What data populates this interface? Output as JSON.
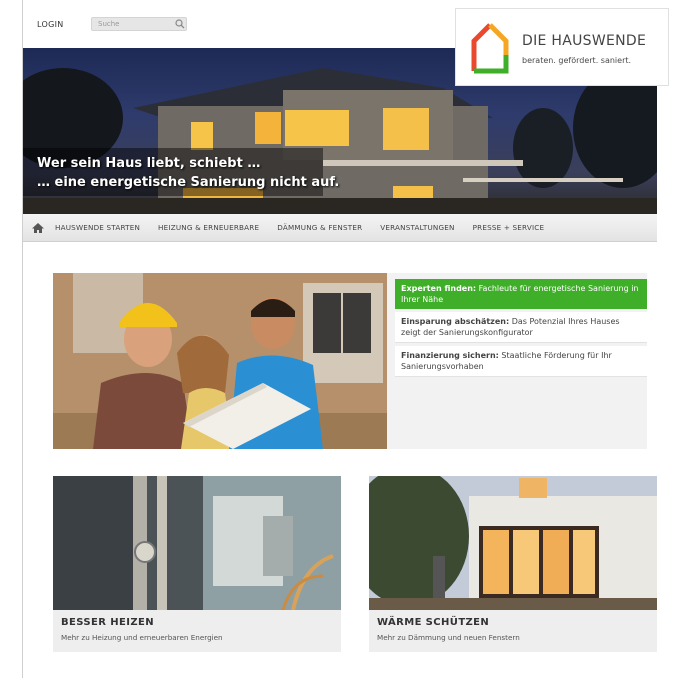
{
  "header": {
    "login_label": "LOGIN",
    "search_placeholder": "Suche"
  },
  "logo": {
    "title": "DIE HAUSWENDE",
    "subtitle": "beraten. gefördert. saniert.",
    "colors": [
      "#e94a2f",
      "#f5a623",
      "#3fae29"
    ]
  },
  "hero": {
    "line1": "Wer sein Haus liebt, schiebt …",
    "line2": "… eine energetische Sanierung nicht auf."
  },
  "nav": {
    "home_icon": "home-icon",
    "items": [
      "HAUSWENDE STARTEN",
      "HEIZUNG & ERNEUERBARE",
      "DÄMMUNG & FENSTER",
      "VERANSTALTUNGEN",
      "PRESSE + SERVICE"
    ]
  },
  "teaser": {
    "links": [
      {
        "bold": "Experten finden:",
        "text": " Fachleute für energetische Sanierung in Ihrer Nähe"
      },
      {
        "bold": "Einsparung abschätzen:",
        "text": " Das Potenzial Ihres Hauses zeigt der Sanierungskonfigurator"
      },
      {
        "bold": "Finanzierung sichern:",
        "text": " Staatliche Förderung für Ihr Sanierungsvorhaben"
      }
    ],
    "accent_color": "#3fae29"
  },
  "cards": [
    {
      "title": "BESSER HEIZEN",
      "subtitle": "Mehr zu Heizung und erneuerbaren Energien"
    },
    {
      "title": "WÄRME SCHÜTZEN",
      "subtitle": "Mehr zu Dämmung und neuen Fenstern"
    }
  ]
}
